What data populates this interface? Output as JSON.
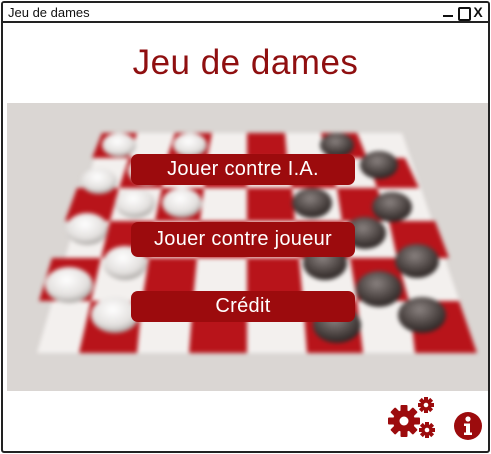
{
  "window": {
    "title": "Jeu de dames",
    "controls": {
      "minimize": "minimize",
      "maximize": "maximize",
      "close": "X"
    }
  },
  "header": {
    "title": "Jeu de dames"
  },
  "menu": {
    "play_ai": "Jouer contre I.A.",
    "play_player": "Jouer contre joueur",
    "credits": "Crédit"
  },
  "footer": {
    "settings_icon": "gears-icon",
    "info_icon": "info-icon"
  },
  "colors": {
    "accent": "#9c0b0d",
    "title": "#8f0f10",
    "board_bg": "#dad6d3",
    "board_red": "#b8141a",
    "board_white": "#f4f2f0"
  }
}
